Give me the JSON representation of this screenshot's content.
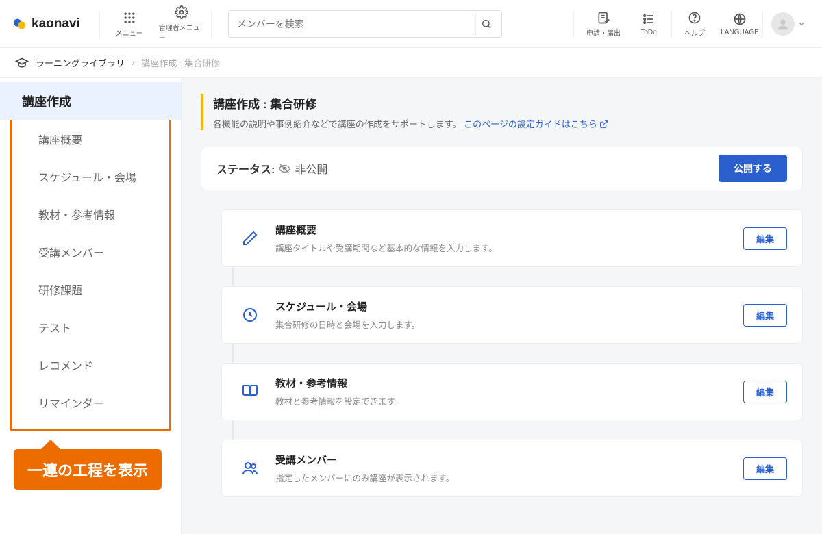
{
  "brand": "kaonavi",
  "topbar": {
    "menu_label": "メニュー",
    "admin_menu_label": "管理者メニュー",
    "search_placeholder": "メンバーを検索",
    "apply_label": "申請・届出",
    "todo_label": "ToDo",
    "help_label": "ヘルプ",
    "language_label": "LANGUAGE"
  },
  "breadcrumb": {
    "root": "ラーニングライブラリ",
    "current": "講座作成 : 集合研修"
  },
  "sidebar": {
    "head": "講座作成",
    "items": [
      "講座概要",
      "スケジュール・会場",
      "教材・参考情報",
      "受講メンバー",
      "研修課題",
      "テスト",
      "レコメンド",
      "リマインダー"
    ]
  },
  "callout": "一連の工程を表示",
  "main": {
    "title": "講座作成 : 集合研修",
    "desc": "各機能の説明や事例紹介などで講座の作成をサポートします。",
    "guide_link": "このページの設定ガイドはこちら",
    "status_label": "ステータス:",
    "status_value": "非公開",
    "publish_btn": "公開する",
    "edit_label": "編集",
    "steps": [
      {
        "title": "講座概要",
        "desc": "講座タイトルや受講期間など基本的な情報を入力します。"
      },
      {
        "title": "スケジュール・会場",
        "desc": "集合研修の日時と会場を入力します。"
      },
      {
        "title": "教材・参考情報",
        "desc": "教材と参考情報を設定できます。"
      },
      {
        "title": "受講メンバー",
        "desc": "指定したメンバーにのみ講座が表示されます。"
      }
    ]
  }
}
